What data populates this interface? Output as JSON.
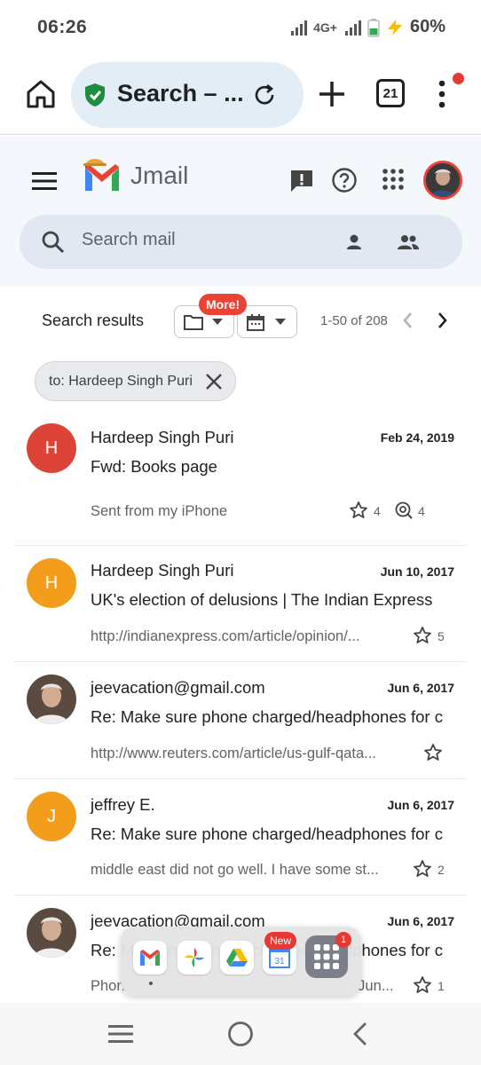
{
  "status": {
    "time": "06:26",
    "network": "4G+",
    "battery": "60%"
  },
  "browser": {
    "omnibox_text": "Search – ...",
    "tab_count": "21"
  },
  "gmail": {
    "app_name": "Jmail",
    "search_placeholder": "Search mail",
    "results_label": "Search results",
    "more_badge": "More!",
    "page_range": "1-50 of 208",
    "filter_chip": "to: Hardeep Singh Puri"
  },
  "emails": [
    {
      "initial": "H",
      "avatar_color": "#db4437",
      "sender": "Hardeep Singh Puri",
      "date": "Feb 24, 2019",
      "subject": "Fwd: Books page",
      "snippet": "Sent from my iPhone",
      "star_count": "4",
      "view_count": "4"
    },
    {
      "initial": "H",
      "avatar_color": "#f29d1b",
      "sender": "Hardeep Singh Puri",
      "date": "Jun 10, 2017",
      "subject": "UK's election of delusions | The Indian Express",
      "snippet": "http://indianexpress.com/article/opinion/...",
      "star_count": "5"
    },
    {
      "initial": "",
      "avatar_color": "#6d5a4c",
      "sender": "jeevacation@gmail.com",
      "date": "Jun 6, 2017",
      "subject": "Re: Make sure phone charged/headphones for c",
      "snippet": "http://www.reuters.com/article/us-gulf-qata...",
      "star_count": ""
    },
    {
      "initial": "J",
      "avatar_color": "#f29d1b",
      "sender": "jeffrey E.",
      "date": "Jun 6, 2017",
      "subject": "Re: Make sure phone charged/headphones for c",
      "snippet": "middle east did not go well. I have some st...",
      "star_count": "2"
    },
    {
      "initial": "",
      "avatar_color": "#6d5a4c",
      "sender": "jeevacation@gmail.com",
      "date": "Jun 6, 2017",
      "subject": "Re: Make sure phone charged/headphones for c",
      "snippet": "Phon",
      "snippet_tail": ", Jun...",
      "star_count": "1"
    }
  ],
  "dock": {
    "new_badge": "New",
    "calendar_day": "31",
    "drawer_badge": "1"
  }
}
